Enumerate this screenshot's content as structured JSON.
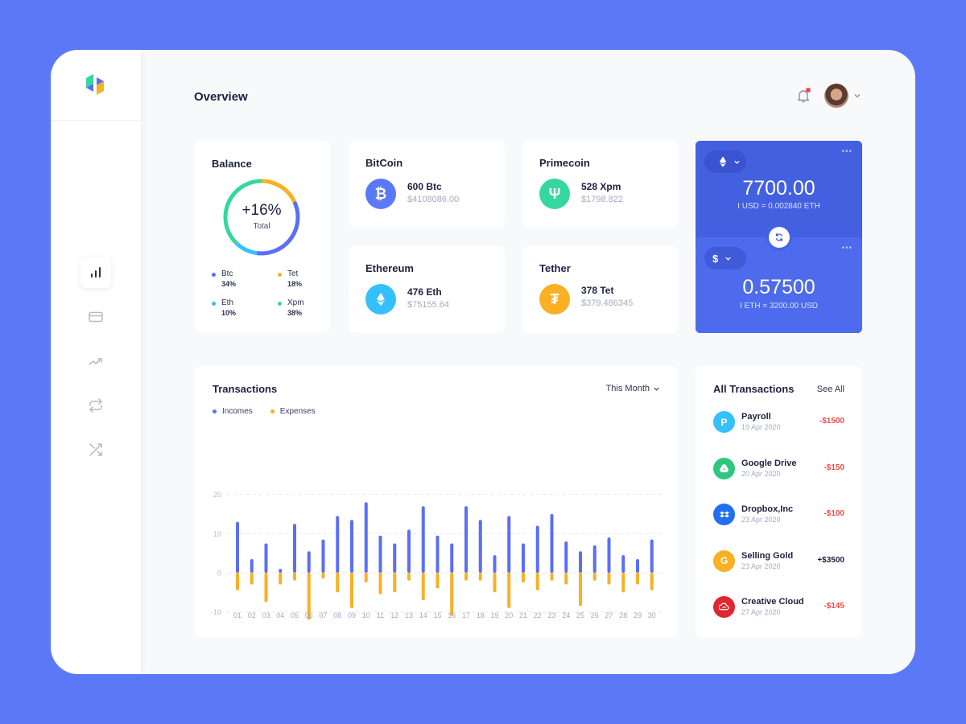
{
  "header": {
    "title": "Overview",
    "notification_badge": true
  },
  "sidebar": {
    "items": [
      {
        "name": "analytics",
        "icon": "bar-chart-icon",
        "active": true
      },
      {
        "name": "cards",
        "icon": "credit-card-icon",
        "active": false
      },
      {
        "name": "trends",
        "icon": "trending-up-icon",
        "active": false
      },
      {
        "name": "exchange",
        "icon": "repeat-icon",
        "active": false
      },
      {
        "name": "shuffle",
        "icon": "shuffle-icon",
        "active": false
      }
    ]
  },
  "balance": {
    "title": "Balance",
    "total_change": "+16%",
    "total_label": "Total",
    "segments": [
      {
        "name": "Btc",
        "pct_label": "34%",
        "value": 34,
        "color": "#5b6ef5"
      },
      {
        "name": "Tet",
        "pct_label": "18%",
        "value": 18,
        "color": "#f8b025"
      },
      {
        "name": "Eth",
        "pct_label": "10%",
        "value": 10,
        "color": "#36c0fb"
      },
      {
        "name": "Xpm",
        "pct_label": "38%",
        "value": 38,
        "color": "#36d6a0"
      }
    ]
  },
  "coins": [
    {
      "title": "BitCoin",
      "amount": "600 Btc",
      "usd": "$4108086.00",
      "icon": "bitcoin-icon",
      "glyph": "₿",
      "color": "#5b79f6"
    },
    {
      "title": "Primecoin",
      "amount": "528 Xpm",
      "usd": "$1798.822",
      "icon": "primecoin-icon",
      "glyph": "Ψ",
      "color": "#36d6a0"
    },
    {
      "title": "Ethereum",
      "amount": "476 Eth",
      "usd": "$75155.64",
      "icon": "ethereum-icon",
      "glyph": "",
      "color": "#36c0fb"
    },
    {
      "title": "Tether",
      "amount": "378 Tet",
      "usd": "$379.486345",
      "icon": "tether-icon",
      "glyph": "₮",
      "color": "#f8b025"
    }
  ],
  "converter": {
    "top": {
      "currency_icon": "ethereum-icon",
      "value": "7700.00",
      "rate": "I USD = 0.002840 ETH",
      "more": "•••"
    },
    "bottom": {
      "currency_symbol": "$",
      "value": "0.57500",
      "rate": "I ETH = 3200.00 USD",
      "more": "•••"
    }
  },
  "transactions": {
    "title": "Transactions",
    "period": "This Month",
    "legend": [
      {
        "label": "Incomes",
        "color": "#5b6ef5"
      },
      {
        "label": "Expenses",
        "color": "#f8b025"
      }
    ]
  },
  "chart_data": {
    "type": "bar",
    "title": "Transactions",
    "xlabel": "",
    "ylabel": "",
    "ylim": [
      -20,
      20
    ],
    "yticks": [
      20,
      10,
      0,
      -10,
      -20
    ],
    "grid": true,
    "legend_position": "top-left",
    "categories": [
      "01",
      "02",
      "03",
      "04",
      "05",
      "06",
      "07",
      "08",
      "09",
      "10",
      "11",
      "12",
      "13",
      "14",
      "15",
      "16",
      "17",
      "18",
      "19",
      "20",
      "21",
      "22",
      "23",
      "24",
      "25",
      "26",
      "27",
      "28",
      "29",
      "30"
    ],
    "series": [
      {
        "name": "Incomes",
        "color": "#5b6ef5",
        "values": [
          13,
          3.5,
          7.5,
          1,
          12.5,
          5.5,
          8.5,
          14.5,
          13.5,
          18,
          9.5,
          7.5,
          11,
          17,
          9.5,
          7.5,
          17,
          13.5,
          4.5,
          14.5,
          7.5,
          12,
          15,
          8,
          5.5,
          7,
          9,
          4.5,
          3.5,
          8.5
        ]
      },
      {
        "name": "Expenses",
        "color": "#f8b025",
        "values": [
          -4.5,
          -3,
          -7.5,
          -3,
          -2,
          -12,
          -1.5,
          -5,
          -9,
          -2.5,
          -5.5,
          -5,
          -2,
          -7,
          -4,
          -11,
          -2,
          -2,
          -5,
          -9,
          -2.5,
          -4.5,
          -2,
          -3,
          -8.5,
          -2,
          -3,
          -5,
          -3,
          -4.5
        ]
      }
    ]
  },
  "all_transactions": {
    "title": "All Transactions",
    "see_all": "See All",
    "items": [
      {
        "name": "Payroll",
        "date": "19 Apr 2020",
        "amount": "-$1500",
        "icon": "payroll-icon",
        "glyph": "P",
        "color": "#36c0fb",
        "amount_color": "#f04a4a"
      },
      {
        "name": "Google Drive",
        "date": "20 Apr 2020",
        "amount": "-$150",
        "icon": "google-drive-icon",
        "glyph": "▲",
        "color": "#2fc77f",
        "amount_color": "#f04a4a"
      },
      {
        "name": "Dropbox,Inc",
        "date": "23 Apr 2020",
        "amount": "-$100",
        "icon": "dropbox-icon",
        "glyph": "❖",
        "color": "#1f6ff0",
        "amount_color": "#f04a4a"
      },
      {
        "name": "Selling Gold",
        "date": "23 Apr 2020",
        "amount": "+$3500",
        "icon": "gold-icon",
        "glyph": "G",
        "color": "#f8b025",
        "amount_color": "#1d2140"
      },
      {
        "name": "Creative Cloud",
        "date": "27 Apr 2020",
        "amount": "-$145",
        "icon": "creative-cloud-icon",
        "glyph": "∞",
        "color": "#e0262e",
        "amount_color": "#f04a4a"
      }
    ]
  }
}
